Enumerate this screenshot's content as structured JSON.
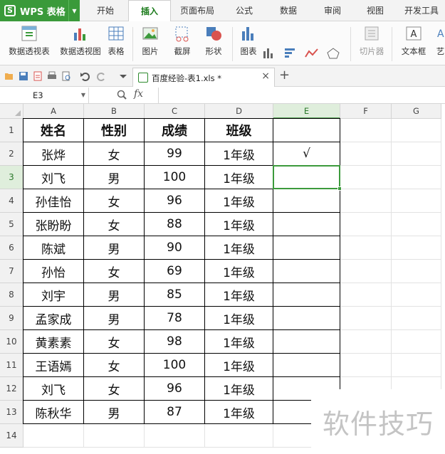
{
  "app": {
    "title": "WPS 表格"
  },
  "menu": {
    "tabs": [
      {
        "label": "开始"
      },
      {
        "label": "插入",
        "active": true
      },
      {
        "label": "页面布局"
      },
      {
        "label": "公式"
      },
      {
        "label": "数据"
      },
      {
        "label": "审阅"
      },
      {
        "label": "视图"
      },
      {
        "label": "开发工具"
      }
    ]
  },
  "ribbon": {
    "pivot_table": "数据透视表",
    "pivot_chart": "数据透视图",
    "table": "表格",
    "picture": "图片",
    "screenshot": "截屏",
    "shapes": "形状",
    "chart": "图表",
    "clipart": "切片器",
    "textbox": "文本框",
    "art": "艺"
  },
  "document": {
    "tab_title": "百度经验-表1.xls *"
  },
  "formula_bar": {
    "name_box": "E3",
    "fx": "fx",
    "value": ""
  },
  "grid": {
    "columns": [
      "A",
      "B",
      "C",
      "D",
      "E",
      "F",
      "G"
    ],
    "rows": [
      "1",
      "2",
      "3",
      "4",
      "5",
      "6",
      "7",
      "8",
      "9",
      "10",
      "11",
      "12",
      "13",
      "14"
    ],
    "selected_cell": "E3",
    "header": [
      "姓名",
      "性别",
      "成绩",
      "班级",
      ""
    ],
    "data": [
      [
        "张烨",
        "女",
        "99",
        "1年级",
        "√"
      ],
      [
        "刘飞",
        "男",
        "100",
        "1年级",
        ""
      ],
      [
        "孙佳怡",
        "女",
        "96",
        "1年级",
        ""
      ],
      [
        "张盼盼",
        "女",
        "88",
        "1年级",
        ""
      ],
      [
        "陈斌",
        "男",
        "90",
        "1年级",
        ""
      ],
      [
        "孙怡",
        "女",
        "69",
        "1年级",
        ""
      ],
      [
        "刘宇",
        "男",
        "85",
        "1年级",
        ""
      ],
      [
        "孟家成",
        "男",
        "78",
        "1年级",
        ""
      ],
      [
        "黄素素",
        "女",
        "98",
        "1年级",
        ""
      ],
      [
        "王语嫣",
        "女",
        "100",
        "1年级",
        ""
      ],
      [
        "刘飞",
        "女",
        "96",
        "1年级",
        ""
      ],
      [
        "陈秋华",
        "男",
        "87",
        "1年级",
        ""
      ]
    ]
  },
  "watermark": "软件技巧",
  "colors": {
    "accent": "#3a9a3a",
    "selection": "#3c9a3c"
  }
}
